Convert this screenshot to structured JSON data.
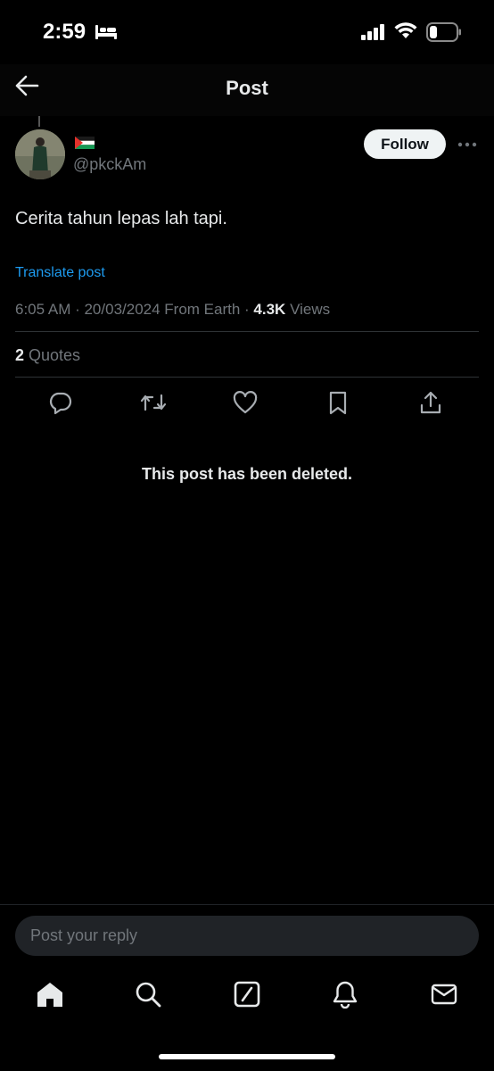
{
  "status_bar": {
    "time": "2:59",
    "icons": [
      "bed-icon",
      "signal-icon",
      "wifi-icon",
      "battery-icon"
    ]
  },
  "header": {
    "title": "Post",
    "back_icon": "arrow-left-icon"
  },
  "post": {
    "handle": "@pkckAm",
    "follow_label": "Follow",
    "text": "Cerita tahun lepas lah tapi.",
    "translate_label": "Translate post",
    "timestamp": "6:05 AM · 20/03/2024 From Earth · ",
    "views_count": "4.3K",
    "views_label": " Views",
    "quotes_count": "2",
    "quotes_label": " Quotes"
  },
  "actions": [
    "reply-icon",
    "repost-icon",
    "like-icon",
    "bookmark-icon",
    "share-icon"
  ],
  "deleted_notice": "This post has been deleted.",
  "reply": {
    "placeholder": "Post your reply"
  },
  "bottom_nav": [
    "home-icon",
    "search-icon",
    "grok-icon",
    "notifications-icon",
    "messages-icon"
  ],
  "colors": {
    "background": "#000000",
    "link": "#1d9bf0",
    "secondary_text": "#71767b",
    "primary_text": "#e7e9ea"
  }
}
